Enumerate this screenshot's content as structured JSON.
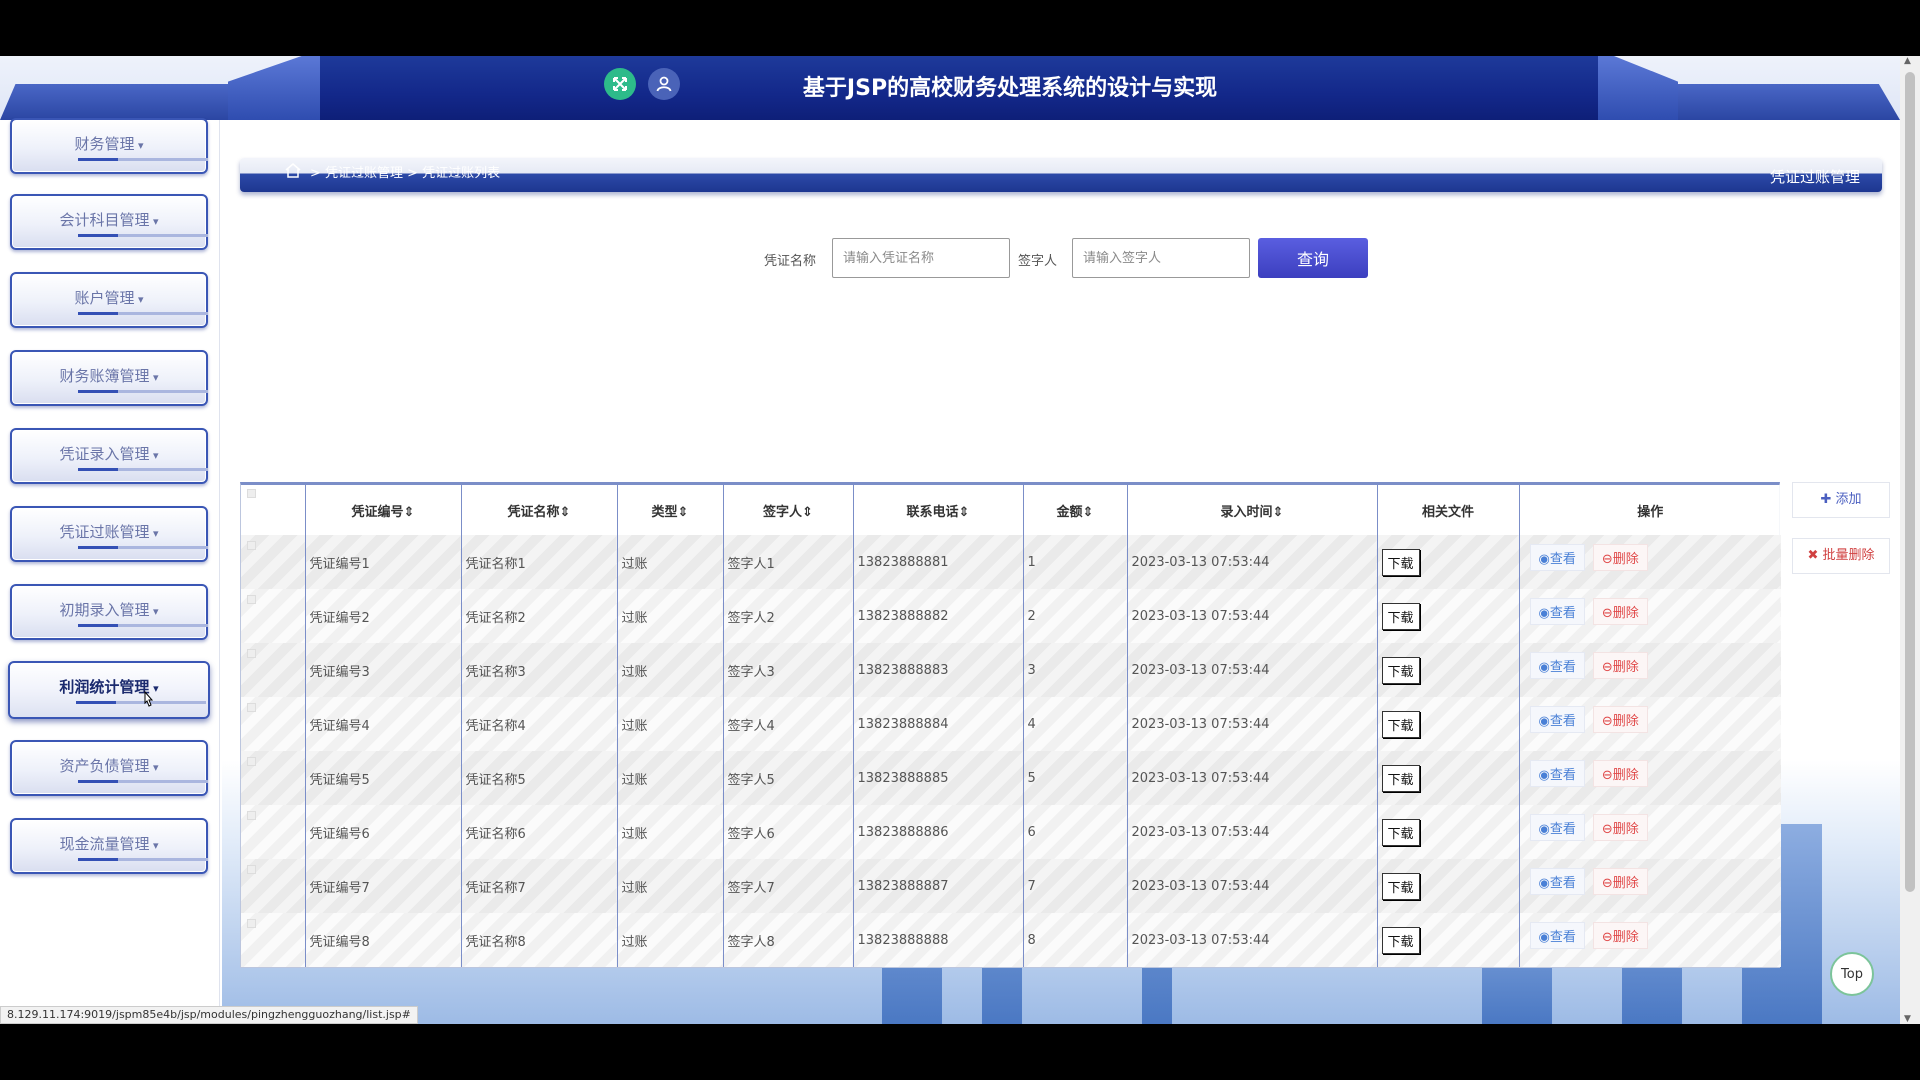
{
  "header": {
    "title": "基于JSP的高校财务处理系统的设计与实现",
    "icons": [
      "expand-icon",
      "user-icon"
    ]
  },
  "sidebar": {
    "items": [
      {
        "label": "财务管理"
      },
      {
        "label": "会计科目管理"
      },
      {
        "label": "账户管理"
      },
      {
        "label": "财务账簿管理"
      },
      {
        "label": "凭证录入管理"
      },
      {
        "label": "凭证过账管理"
      },
      {
        "label": "初期录入管理"
      },
      {
        "label": "利润统计管理",
        "active": true
      },
      {
        "label": "资产负债管理"
      },
      {
        "label": "现金流量管理"
      }
    ]
  },
  "breadcrumb": {
    "path": "> 凭证过账管理 > 凭证过账列表",
    "right_title": "凭证过账管理"
  },
  "search": {
    "name_label": "凭证名称",
    "name_placeholder": "请输入凭证名称",
    "signer_label": "签字人",
    "signer_placeholder": "请输入签字人",
    "query_label": "查询"
  },
  "actions": {
    "add_label": "添加",
    "batch_delete_label": "批量删除"
  },
  "table": {
    "headers": [
      "凭证编号",
      "凭证名称",
      "类型",
      "签字人",
      "联系电话",
      "金额",
      "录入时间",
      "相关文件",
      "操作"
    ],
    "sort_glyph": "⇕",
    "download_label": "下载",
    "view_label": "查看",
    "delete_label": "删除",
    "rows": [
      {
        "code": "凭证编号1",
        "name": "凭证名称1",
        "type": "过账",
        "signer": "签字人1",
        "phone": "13823888881",
        "amount": "1",
        "time": "2023-03-13 07:53:44"
      },
      {
        "code": "凭证编号2",
        "name": "凭证名称2",
        "type": "过账",
        "signer": "签字人2",
        "phone": "13823888882",
        "amount": "2",
        "time": "2023-03-13 07:53:44"
      },
      {
        "code": "凭证编号3",
        "name": "凭证名称3",
        "type": "过账",
        "signer": "签字人3",
        "phone": "13823888883",
        "amount": "3",
        "time": "2023-03-13 07:53:44"
      },
      {
        "code": "凭证编号4",
        "name": "凭证名称4",
        "type": "过账",
        "signer": "签字人4",
        "phone": "13823888884",
        "amount": "4",
        "time": "2023-03-13 07:53:44"
      },
      {
        "code": "凭证编号5",
        "name": "凭证名称5",
        "type": "过账",
        "signer": "签字人5",
        "phone": "13823888885",
        "amount": "5",
        "time": "2023-03-13 07:53:44"
      },
      {
        "code": "凭证编号6",
        "name": "凭证名称6",
        "type": "过账",
        "signer": "签字人6",
        "phone": "13823888886",
        "amount": "6",
        "time": "2023-03-13 07:53:44"
      },
      {
        "code": "凭证编号7",
        "name": "凭证名称7",
        "type": "过账",
        "signer": "签字人7",
        "phone": "13823888887",
        "amount": "7",
        "time": "2023-03-13 07:53:44"
      },
      {
        "code": "凭证编号8",
        "name": "凭证名称8",
        "type": "过账",
        "signer": "签字人8",
        "phone": "13823888888",
        "amount": "8",
        "time": "2023-03-13 07:53:44"
      }
    ]
  },
  "top_button_label": "Top",
  "status_url": "8.129.11.174:9019/jspm85e4b/jsp/modules/pingzhengguozhang/list.jsp#"
}
